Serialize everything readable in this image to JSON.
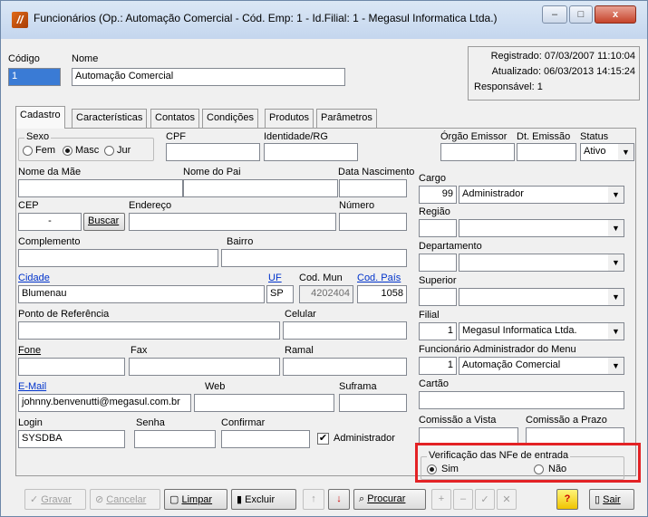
{
  "window": {
    "title": "Funcionários (Op.: Automação Comercial - Cód. Emp: 1 - Id.Filial: 1 - Megasul Informatica Ltda.)",
    "minimize": "–",
    "maximize": "□",
    "close": "x"
  },
  "header": {
    "codigo_label": "Código",
    "codigo_value": "1",
    "nome_label": "Nome",
    "nome_value": "Automação Comercial",
    "registrado": "Registrado:  07/03/2007 11:10:04",
    "atualizado": "Atualizado:  06/03/2013 14:15:24",
    "responsavel": "Responsável:  1"
  },
  "tabs": [
    "Cadastro",
    "Características",
    "Contatos",
    "Condições",
    "Produtos",
    "Parâmetros"
  ],
  "cadastro": {
    "sexo_title": "Sexo",
    "sexo_options": [
      "Fem",
      "Masc",
      "Jur"
    ],
    "cpf_label": "CPF",
    "identidade_label": "Identidade/RG",
    "orgao_label": "Órgão Emissor",
    "dt_emissao_label": "Dt. Emissão",
    "status_label": "Status",
    "status_value": "Ativo",
    "mae_label": "Nome da Mãe",
    "pai_label": "Nome do Pai",
    "nascimento_label": "Data Nascimento",
    "cep_label": "CEP",
    "cep_value": "-",
    "buscar": "Buscar",
    "endereco_label": "Endereço",
    "numero_label": "Número",
    "complemento_label": "Complemento",
    "bairro_label": "Bairro",
    "cidade_label": "Cidade",
    "cidade_value": "Blumenau",
    "uf_label": "UF",
    "uf_value": "SP",
    "cod_mun_label": "Cod. Mun",
    "cod_mun_value": "4202404",
    "cod_pais_label": "Cod. País",
    "cod_pais_value": "1058",
    "ponto_ref_label": "Ponto de Referência",
    "celular_label": "Celular",
    "fone_label": "Fone",
    "fax_label": "Fax",
    "ramal_label": "Ramal",
    "email_label": "E-Mail",
    "email_value": "johnny.benvenutti@megasul.com.br",
    "web_label": "Web",
    "suframa_label": "Suframa",
    "login_label": "Login",
    "login_value": "SYSDBA",
    "senha_label": "Senha",
    "confirmar_label": "Confirmar",
    "administrador_label": "Administrador",
    "administrador_check": "✔",
    "cargo_label": "Cargo",
    "cargo_code": "99",
    "cargo_value": "Administrador",
    "regiao_label": "Região",
    "departamento_label": "Departamento",
    "superior_label": "Superior",
    "filial_label": "Filial",
    "filial_code": "1",
    "filial_value": "Megasul Informatica Ltda.",
    "func_admin_label": "Funcionário Administrador do Menu",
    "func_admin_code": "1",
    "func_admin_value": "Automação Comercial",
    "cartao_label": "Cartão",
    "comissao_vista_label": "Comissão a Vista",
    "comissao_prazo_label": "Comissão a Prazo",
    "nfe_title": "Verificação das NFe de entrada",
    "nfe_sim": "Sim",
    "nfe_nao": "Não",
    "dropdown_arrow": "▼"
  },
  "toolbar": {
    "gravar": "Gravar",
    "cancelar": "Cancelar",
    "limpar": "Limpar",
    "excluir": "Excluir",
    "up": "↑",
    "down": "↓",
    "procurar": "Procurar",
    "plus": "+",
    "minus": "–",
    "check": "✓",
    "x": "✕",
    "help": "?",
    "sair": "Sair",
    "gravar_icon": "✓",
    "cancelar_icon": "⊘",
    "limpar_icon": "▢",
    "excluir_icon": "▮",
    "procurar_icon": "⌕",
    "sair_icon": "▯"
  },
  "colors": {
    "highlight": "#e32225",
    "link": "#0033cc"
  }
}
